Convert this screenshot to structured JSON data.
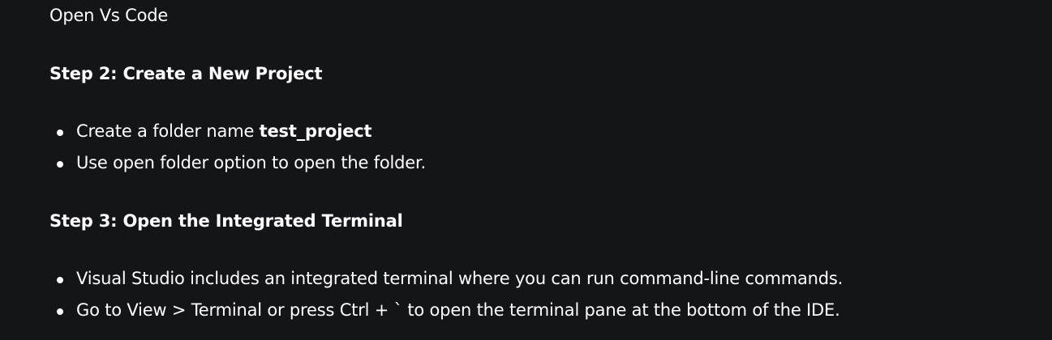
{
  "intro": {
    "text": "Open Vs Code"
  },
  "step2": {
    "heading": "Step 2: Create a New Project",
    "items": [
      {
        "text": "Create a folder name ",
        "bold": "test_project"
      },
      {
        "text": "Use open folder option to open the folder."
      }
    ]
  },
  "step3": {
    "heading": "Step 3: Open the Integrated Terminal",
    "items": [
      {
        "text": "Visual Studio includes an integrated terminal where you can run command-line commands."
      },
      {
        "text": "Go to View > Terminal or press Ctrl + ` to open the terminal pane at the bottom of the IDE."
      }
    ]
  }
}
